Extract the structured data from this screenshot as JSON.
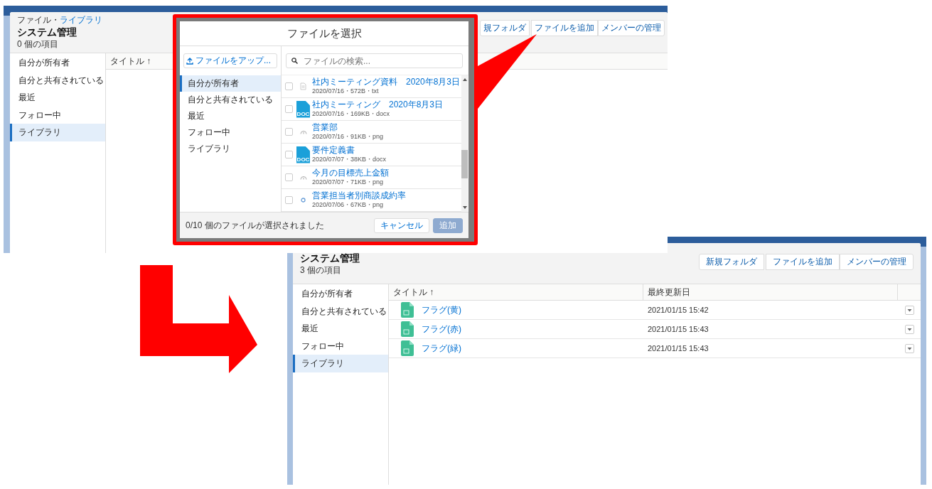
{
  "before": {
    "breadcrumb": {
      "parent": "ファイル",
      "separator": "・",
      "current": "ライブラリ"
    },
    "title": "システム管理",
    "count": "0 個の項目",
    "buttons": [
      "規フォルダ",
      "ファイルを追加",
      "メンバーの管理"
    ],
    "sidebar": [
      {
        "label": "自分が所有者",
        "selected": false
      },
      {
        "label": "自分と共有されている",
        "selected": false
      },
      {
        "label": "最近",
        "selected": false
      },
      {
        "label": "フォロー中",
        "selected": false
      },
      {
        "label": "ライブラリ",
        "selected": true
      }
    ],
    "columns": [
      {
        "label": "タイトル ↑"
      }
    ],
    "dialog": {
      "title": "ファイルを選択",
      "upload_button": "ファイルをアップ...",
      "search_placeholder": "ファイルの検索...",
      "sidebar": [
        {
          "label": "自分が所有者",
          "selected": true
        },
        {
          "label": "自分と共有されている",
          "selected": false
        },
        {
          "label": "最近",
          "selected": false
        },
        {
          "label": "フォロー中",
          "selected": false
        },
        {
          "label": "ライブラリ",
          "selected": false
        }
      ],
      "files": [
        {
          "kind": "txt",
          "name": "社内ミーティング資料　2020年8月3日",
          "meta": "2020/07/16・572B・txt",
          "checked": false
        },
        {
          "kind": "doc",
          "icon_label": "DOC",
          "name": "社内ミーティング　2020年8月3日",
          "meta": "2020/07/16・169KB・docx",
          "checked": false
        },
        {
          "kind": "image",
          "name": "営業部",
          "meta": "2020/07/16・91KB・png",
          "checked": false
        },
        {
          "kind": "doc",
          "icon_label": "DOC",
          "name": "要件定義書",
          "meta": "2020/07/07・38KB・docx",
          "checked": false
        },
        {
          "kind": "image",
          "name": "今月の目標売上金額",
          "meta": "2020/07/07・71KB・png",
          "checked": false
        },
        {
          "kind": "dot",
          "name": "営業担当者別商談成約率",
          "meta": "2020/07/06・67KB・png",
          "checked": false
        }
      ],
      "status": "0/10 個のファイルが選択されました",
      "buttons": [
        {
          "label": "キャンセル",
          "disabled": false
        },
        {
          "label": "追加",
          "disabled": true
        }
      ]
    }
  },
  "after": {
    "title": "システム管理",
    "count": "3 個の項目",
    "buttons": [
      "新規フォルダ",
      "ファイルを追加",
      "メンバーの管理"
    ],
    "sidebar": [
      {
        "label": "自分が所有者",
        "selected": false
      },
      {
        "label": "自分と共有されている",
        "selected": false
      },
      {
        "label": "最近",
        "selected": false
      },
      {
        "label": "フォロー中",
        "selected": false
      },
      {
        "label": "ライブラリ",
        "selected": true
      }
    ],
    "columns": [
      {
        "label": "タイトル ↑"
      },
      {
        "label": "最終更新日"
      }
    ],
    "rows": [
      {
        "kind": "image",
        "title": "フラグ(黄)",
        "updated": "2021/01/15 15:42"
      },
      {
        "kind": "image",
        "title": "フラグ(赤)",
        "updated": "2021/01/15 15:43"
      },
      {
        "kind": "image",
        "title": "フラグ(緑)",
        "updated": "2021/01/15 15:43"
      }
    ]
  }
}
